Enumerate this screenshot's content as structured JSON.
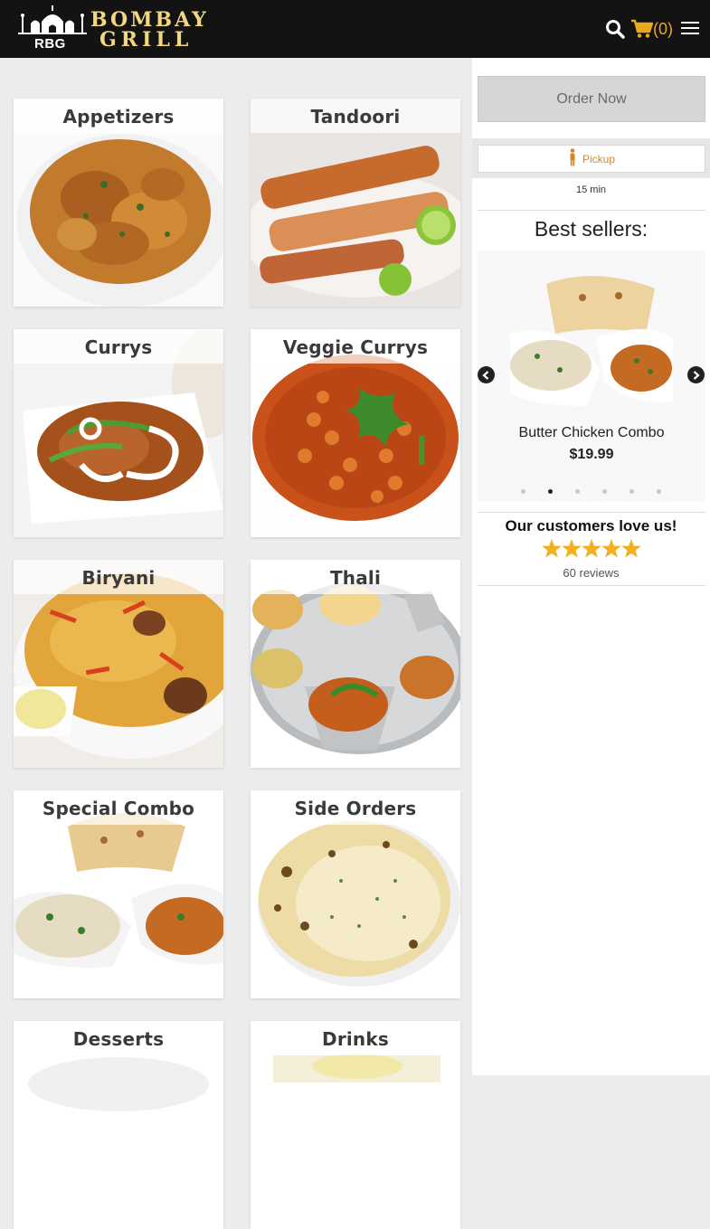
{
  "header": {
    "logo_abbrev": "RBG",
    "logo_line1": "BOMBAY",
    "logo_line2": "GRILL",
    "cart_count": "(0)",
    "icons": [
      "search-icon",
      "cart-icon",
      "menu-icon"
    ]
  },
  "categories": [
    {
      "label": "Appetizers"
    },
    {
      "label": "Tandoori"
    },
    {
      "label": "Currys"
    },
    {
      "label": "Veggie Currys"
    },
    {
      "label": "Biryani"
    },
    {
      "label": "Thali"
    },
    {
      "label": "Special Combo"
    },
    {
      "label": "Side Orders"
    },
    {
      "label": "Desserts"
    },
    {
      "label": "Drinks"
    }
  ],
  "sidebar": {
    "order_button": "Order Now",
    "pickup_label": "Pickup",
    "pickup_time": "15 min",
    "best_sellers_title": "Best sellers:",
    "carousel": {
      "item_name": "Butter Chicken Combo",
      "item_price": "$19.99",
      "prev_label": "Previous",
      "next_label": "Next",
      "slide_count": 6,
      "active_slide": 2
    },
    "reviews": {
      "headline": "Our customers love us!",
      "rating_stars": 5,
      "count_text": "60 reviews"
    }
  },
  "colors": {
    "header_bg": "#131313",
    "brand_gold": "#f3d77c",
    "cart_orange": "#e8a81f",
    "star_gold": "#f2b01e",
    "pickup_orange": "#cf8a2a"
  }
}
